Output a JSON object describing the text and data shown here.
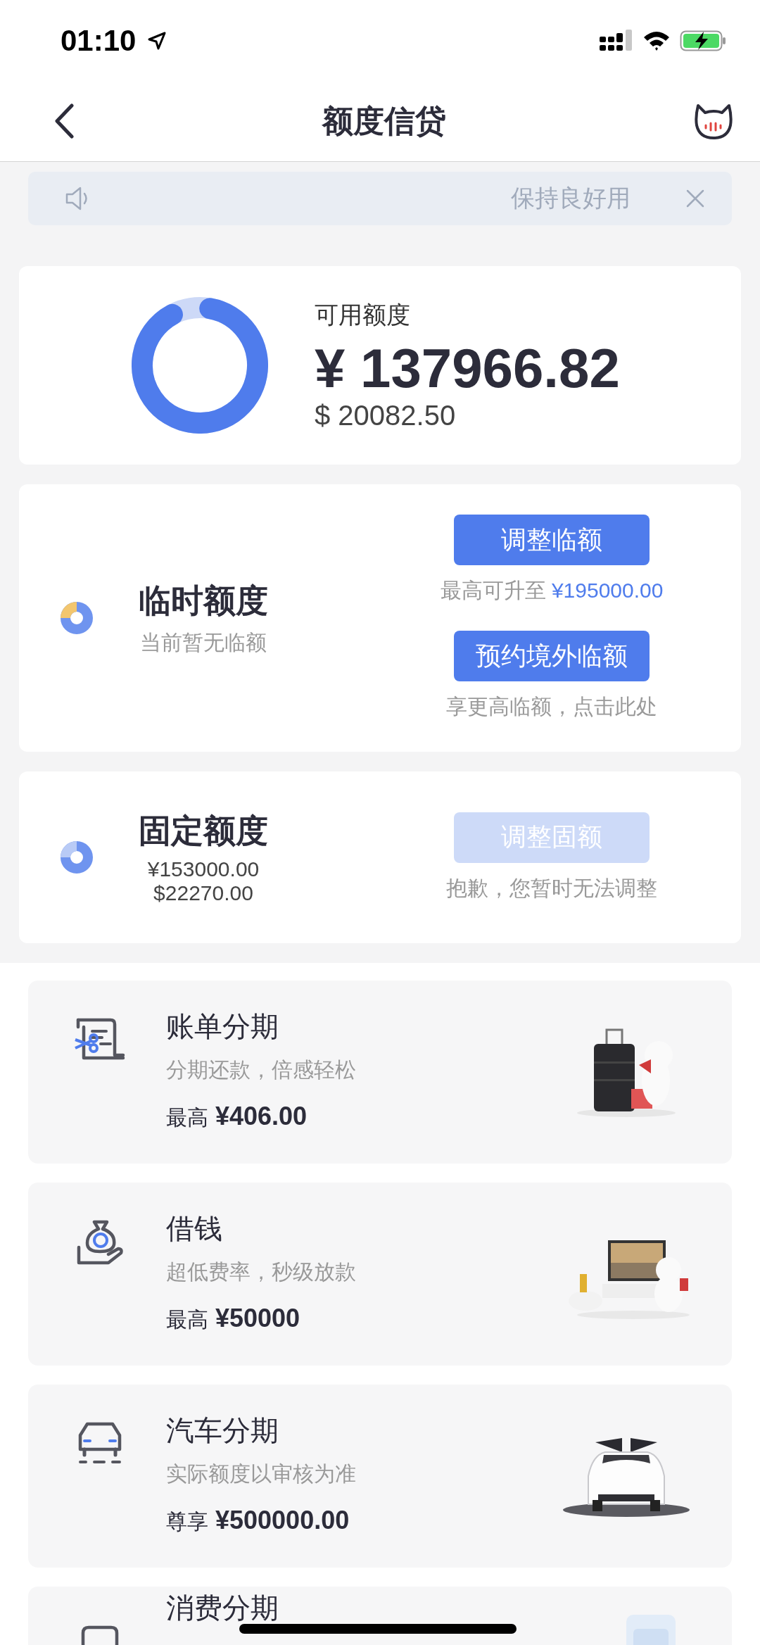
{
  "status_bar": {
    "time": "01:10"
  },
  "nav": {
    "title": "额度信贷"
  },
  "notice": {
    "text": "保持良好用"
  },
  "available": {
    "label": "可用额度",
    "amount": "¥ 137966.82",
    "usd": "$ 20082.50",
    "level": 0.95
  },
  "temporary": {
    "title": "临时额度",
    "subtitle": "当前暂无临额",
    "actions": [
      {
        "button": "调整临额",
        "disabled": false,
        "note": "最高可升至",
        "highlight": "¥195000.00"
      },
      {
        "button": "预约境外临额",
        "disabled": false,
        "note": "享更高临额，点击此处"
      }
    ]
  },
  "fixed": {
    "title": "固定额度",
    "amounts": [
      "¥153000.00",
      "$22270.00"
    ],
    "button": "调整固额",
    "disabled": true,
    "note": "抱歉，您暂时无法调整"
  },
  "products": [
    {
      "kind": "bill",
      "title": "账单分期",
      "subtitle": "分期还款，倍感轻松",
      "amount_label": "最高",
      "amount": "¥406.00"
    },
    {
      "kind": "loan",
      "title": "借钱",
      "subtitle": "超低费率，秒级放款",
      "amount_label": "最高",
      "amount": "¥50000"
    },
    {
      "kind": "car",
      "title": "汽车分期",
      "subtitle": "实际额度以审核为准",
      "amount_label": "尊享",
      "amount": "¥500000.00"
    },
    {
      "kind": "consumer",
      "title": "消费分期"
    }
  ]
}
